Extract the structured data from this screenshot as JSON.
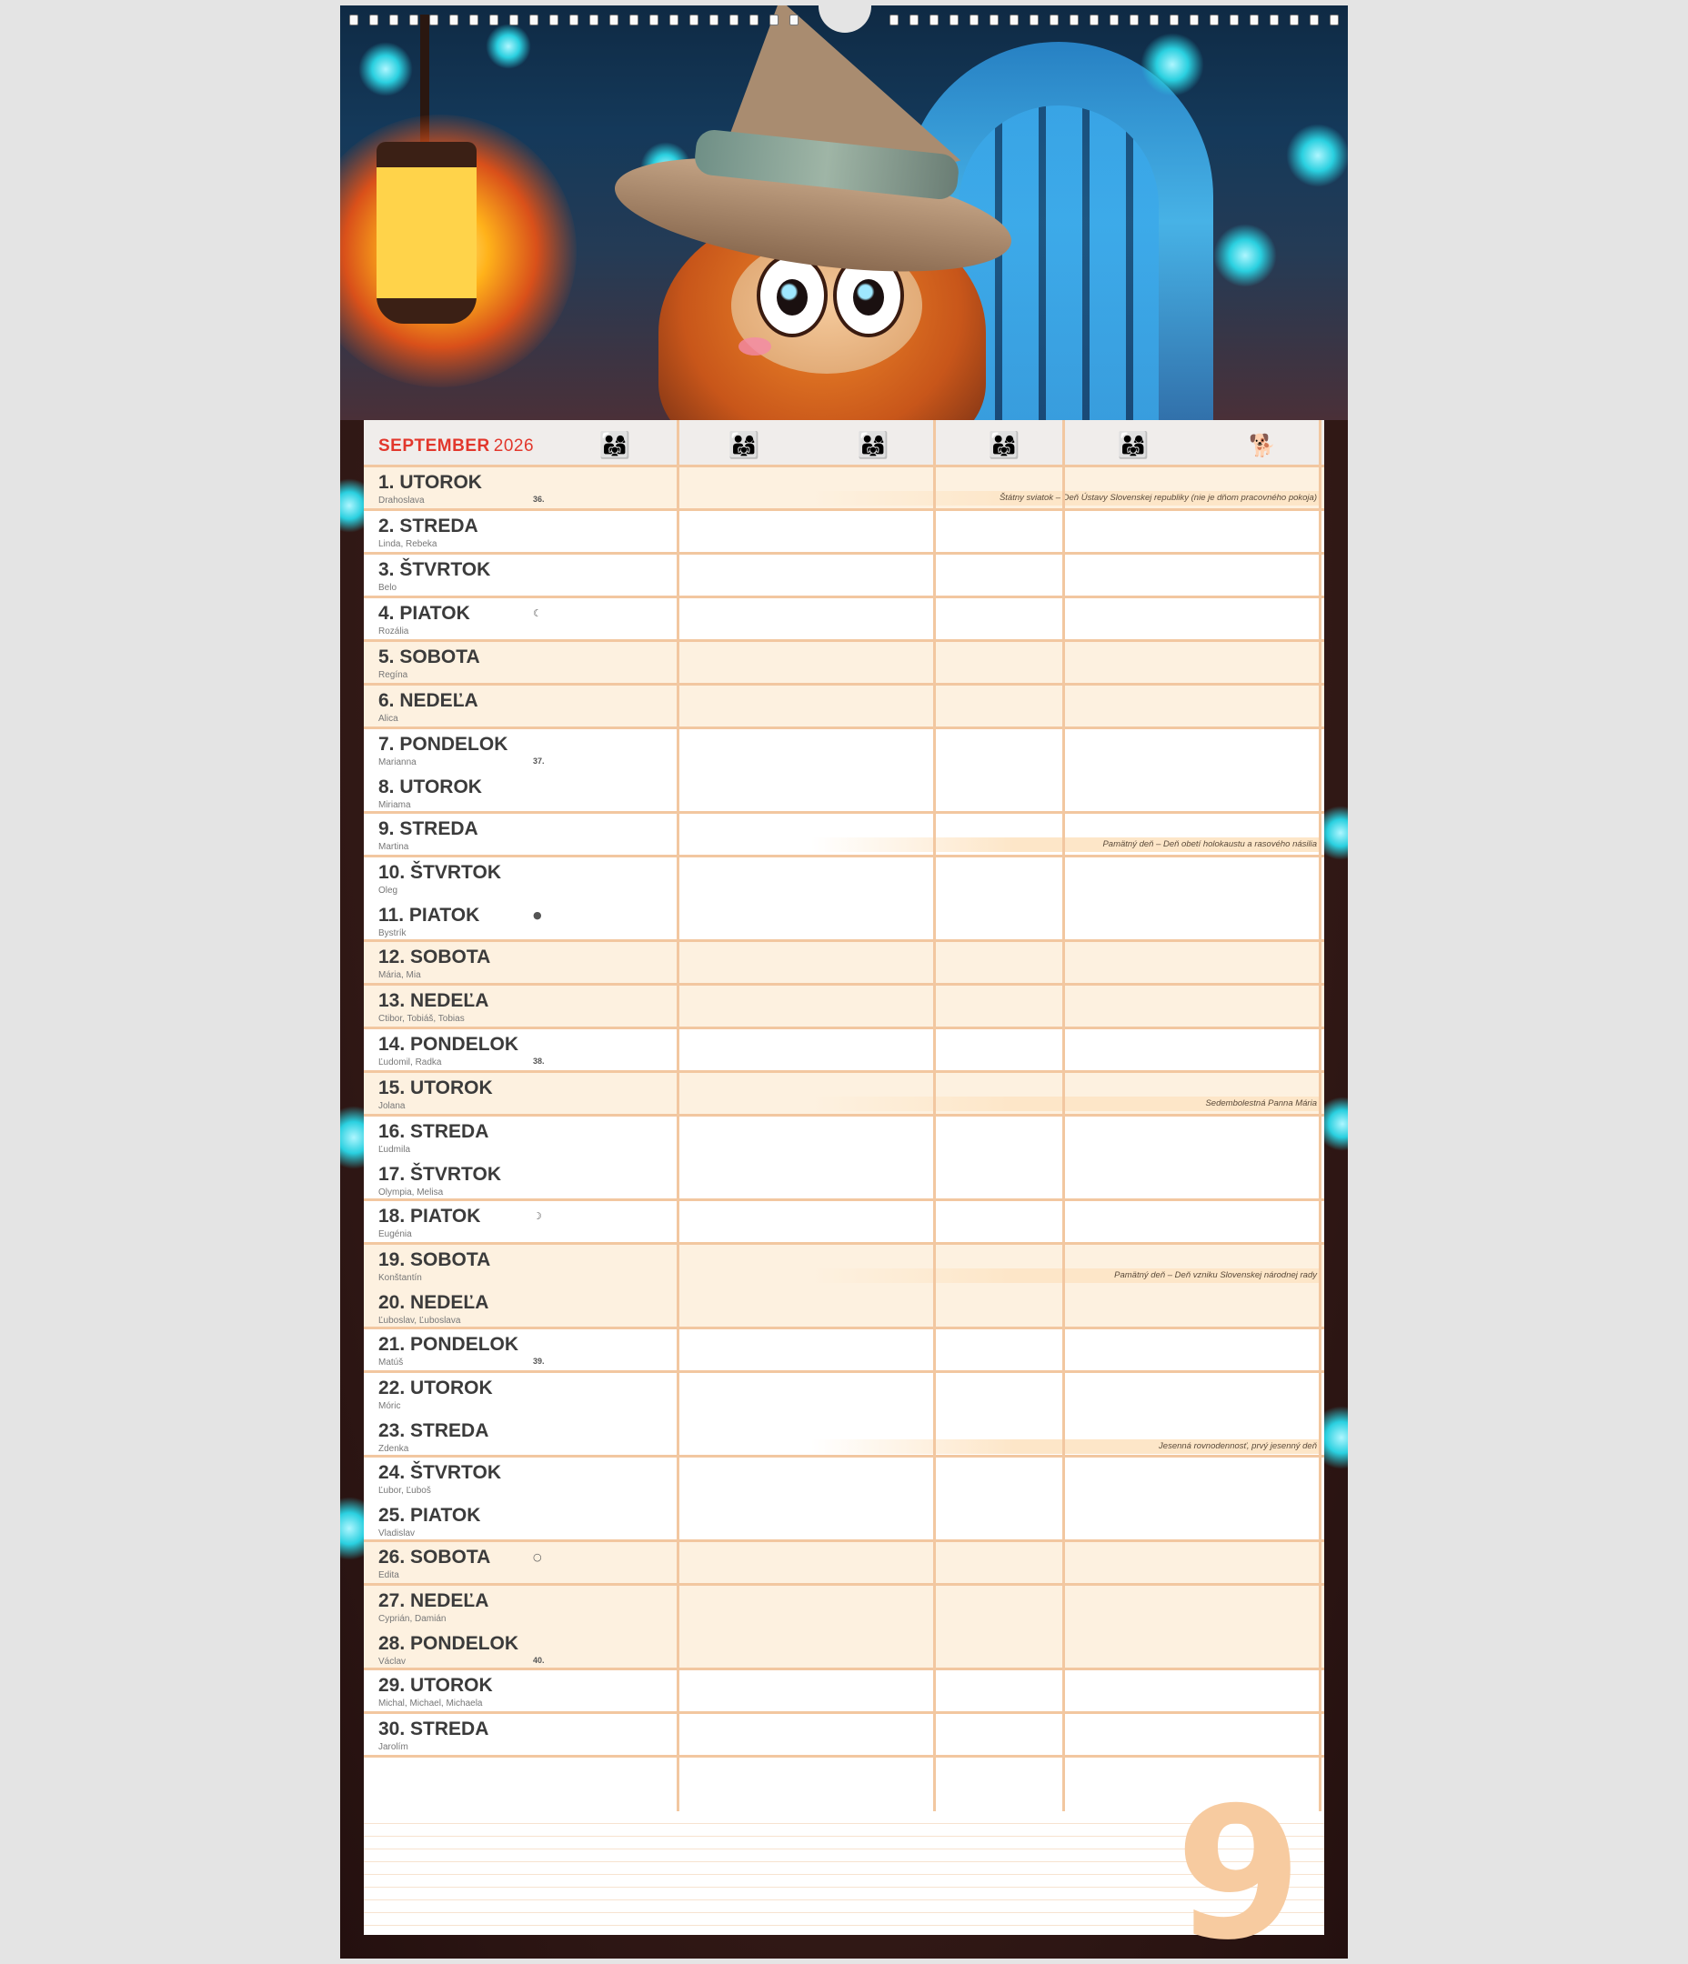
{
  "calendar": {
    "month": "SEPTEMBER",
    "year": "2026",
    "month_number": "9",
    "column_icons": [
      "family-icon",
      "family-icon",
      "family-icon",
      "family-icon",
      "family-icon",
      "pets-icon"
    ],
    "days": [
      {
        "title": "1. UTOROK",
        "names": "Drahoslava",
        "week": "36.",
        "weekend": true,
        "holiday": "Štátny sviatok – Deň Ústavy Slovenskej republiky (nie je dňom pracovného pokoja)"
      },
      {
        "title": "2. STREDA",
        "names": "Linda, Rebeka"
      },
      {
        "title": "3. ŠTVRTOK",
        "names": "Belo"
      },
      {
        "title": "4. PIATOK",
        "names": "Rozália",
        "moon": "☾"
      },
      {
        "title": "5. SOBOTA",
        "names": "Regína",
        "weekend": true
      },
      {
        "title": "6. NEDEĽA",
        "names": "Alica",
        "weekend": true
      },
      {
        "title": "7. PONDELOK",
        "names": "Marianna",
        "week": "37."
      },
      {
        "title": "8. UTOROK",
        "names": "Miriama"
      },
      {
        "title": "9. STREDA",
        "names": "Martina",
        "holiday": "Pamätný deň – Deň obetí holokaustu a rasového násilia"
      },
      {
        "title": "10. ŠTVRTOK",
        "names": "Oleg"
      },
      {
        "title": "11. PIATOK",
        "names": "Bystrík",
        "moon": "●"
      },
      {
        "title": "12. SOBOTA",
        "names": "Mária, Mia",
        "weekend": true
      },
      {
        "title": "13. NEDEĽA",
        "names": "Ctibor, Tobiáš, Tobias",
        "weekend": true
      },
      {
        "title": "14. PONDELOK",
        "names": "Ľudomil, Radka",
        "week": "38."
      },
      {
        "title": "15. UTOROK",
        "names": "Jolana",
        "weekend": true,
        "holiday": "Sedembolestná Panna Mária"
      },
      {
        "title": "16. STREDA",
        "names": "Ľudmila"
      },
      {
        "title": "17. ŠTVRTOK",
        "names": "Olympia, Melisa"
      },
      {
        "title": "18. PIATOK",
        "names": "Eugénia",
        "moon": "☽"
      },
      {
        "title": "19. SOBOTA",
        "names": "Konštantín",
        "weekend": true,
        "holiday": "Pamätný deň – Deň vzniku Slovenskej národnej rady"
      },
      {
        "title": "20. NEDEĽA",
        "names": "Ľuboslav, Ľuboslava",
        "weekend": true
      },
      {
        "title": "21. PONDELOK",
        "names": "Matúš",
        "week": "39."
      },
      {
        "title": "22. UTOROK",
        "names": "Móric"
      },
      {
        "title": "23. STREDA",
        "names": "Zdenka",
        "holiday": "Jesenná rovnodennosť, prvý jesenný deň"
      },
      {
        "title": "24. ŠTVRTOK",
        "names": "Ľubor, Ľuboš"
      },
      {
        "title": "25. PIATOK",
        "names": "Vladislav"
      },
      {
        "title": "26. SOBOTA",
        "names": "Edita",
        "weekend": true,
        "moon": "○"
      },
      {
        "title": "27. NEDEĽA",
        "names": "Cyprián, Damián",
        "weekend": true
      },
      {
        "title": "28. PONDELOK",
        "names": "Václav",
        "week": "40.",
        "weekend": true
      },
      {
        "title": "29. UTOROK",
        "names": "Michal, Michael, Michaela"
      },
      {
        "title": "30. STREDA",
        "names": "Jarolím"
      }
    ]
  },
  "colors": {
    "accent_red": "#e2372c",
    "grid_line": "#f2c7a0",
    "weekend_fill": "#fdf1e0",
    "big_number": "#f7cba0"
  }
}
